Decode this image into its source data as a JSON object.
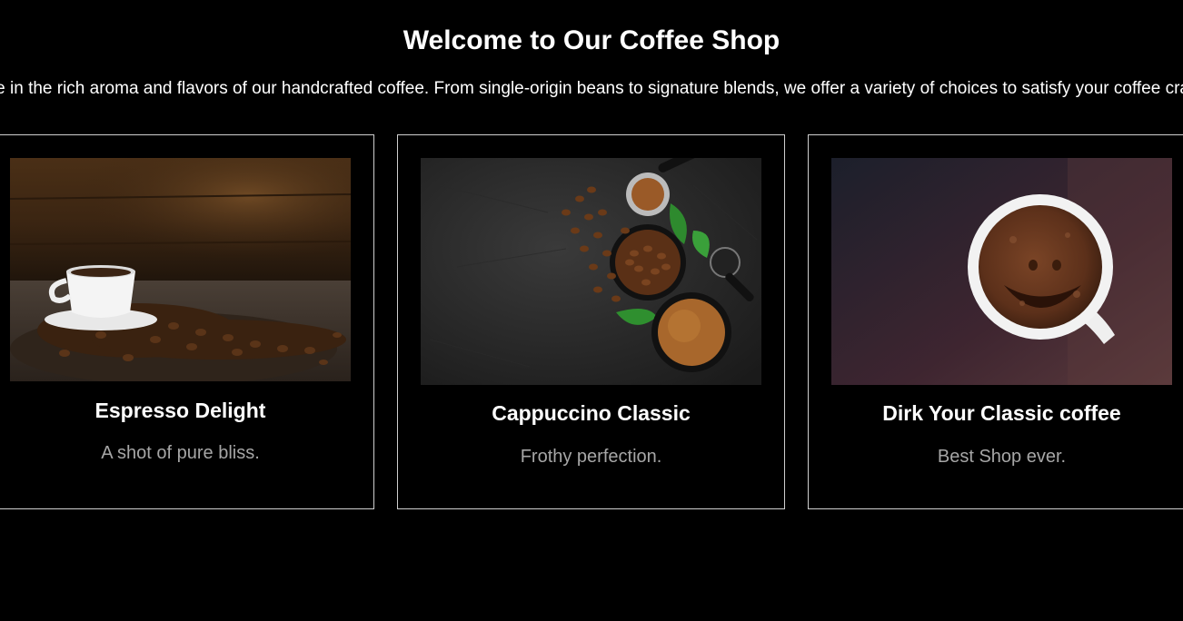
{
  "header": {
    "title": "Welcome to Our Coffee Shop",
    "intro": "Indulge in the rich aroma and flavors of our handcrafted coffee. From single-origin beans to signature blends, we offer a variety of choices to satisfy your coffee cravings."
  },
  "cards": [
    {
      "title": "Espresso Delight",
      "description": "A shot of pure bliss.",
      "image_icon": "espresso-cup-with-beans-image"
    },
    {
      "title": "Cappuccino Classic",
      "description": "Frothy perfection.",
      "image_icon": "coffee-beans-and-grounds-image"
    },
    {
      "title": "Dirk Your Classic coffee",
      "description": "Best Shop ever.",
      "image_icon": "smiley-coffee-cup-image"
    }
  ],
  "colors": {
    "background": "#000000",
    "text": "#ffffff",
    "muted_text": "#a6a6a6",
    "card_border": "#cfcfcf"
  }
}
